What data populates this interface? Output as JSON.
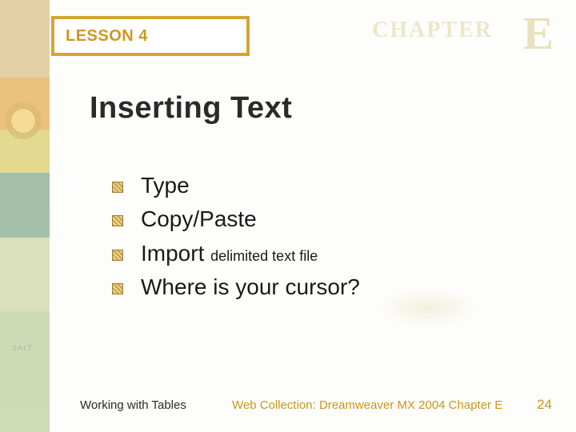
{
  "header": {
    "lesson_label": "LESSON 4",
    "chapter_word": "CHAPTER",
    "chapter_letter": "E"
  },
  "title": "Inserting Text",
  "bullets": [
    {
      "main": "Type",
      "sub": ""
    },
    {
      "main": "Copy/Paste",
      "sub": ""
    },
    {
      "main": "Import",
      "sub": "delimited text file"
    },
    {
      "main": "Where is your cursor?",
      "sub": ""
    }
  ],
  "footer": {
    "left": "Working with Tables",
    "center": "Web Collection: Dreamweaver MX 2004 Chapter E",
    "page": "24"
  }
}
